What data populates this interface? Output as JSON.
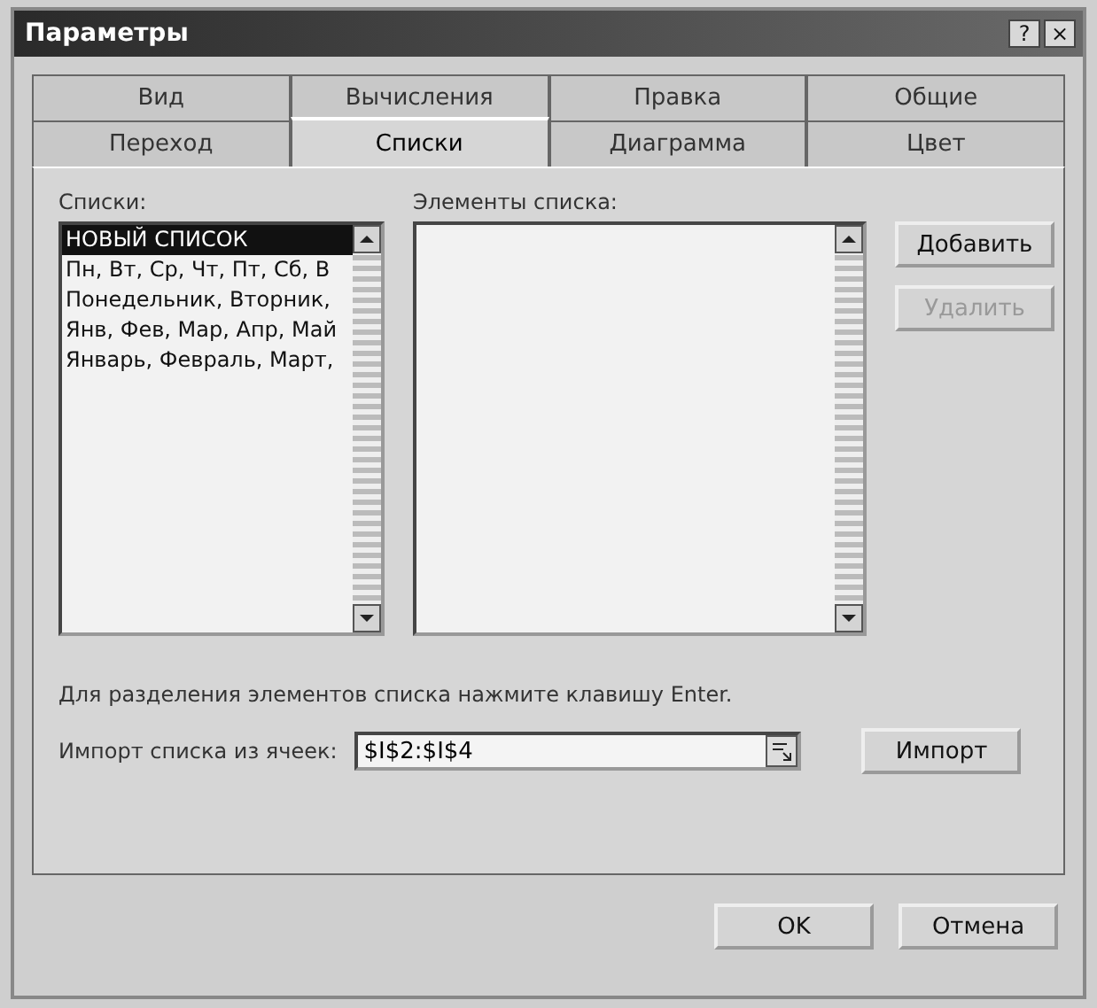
{
  "window": {
    "title": "Параметры",
    "title_buttons": [
      "?",
      "×"
    ]
  },
  "tab_rows": [
    [
      {
        "label": "Вид",
        "selected": false
      },
      {
        "label": "Вычисления",
        "selected": false
      },
      {
        "label": "Правка",
        "selected": false
      },
      {
        "label": "Общие",
        "selected": false
      }
    ],
    [
      {
        "label": "Переход",
        "selected": false
      },
      {
        "label": "Списки",
        "selected": true
      },
      {
        "label": "Диаграмма",
        "selected": false
      },
      {
        "label": "Цвет",
        "selected": false
      }
    ]
  ],
  "lists": {
    "label": "Списки:",
    "items": [
      {
        "text": "НОВЫЙ СПИСОК",
        "selected": true
      },
      {
        "text": "Пн, Вт, Ср, Чт, Пт, Сб, В",
        "selected": false
      },
      {
        "text": "Понедельник, Вторник,",
        "selected": false
      },
      {
        "text": "Янв, Фев, Мар, Апр, Май",
        "selected": false
      },
      {
        "text": "Январь, Февраль, Март,",
        "selected": false
      }
    ]
  },
  "list_entries": {
    "label": "Элементы списка:"
  },
  "side_buttons": [
    {
      "label": "Добавить",
      "disabled": false
    },
    {
      "label": "Удалить",
      "disabled": true
    }
  ],
  "hint": "Для разделения элементов списка нажмите клавишу Enter.",
  "import": {
    "label": "Импорт списка из ячеек:",
    "value": "$I$2:$I$4",
    "button": "Импорт"
  },
  "buttons": [
    "OK",
    "Отмена"
  ]
}
